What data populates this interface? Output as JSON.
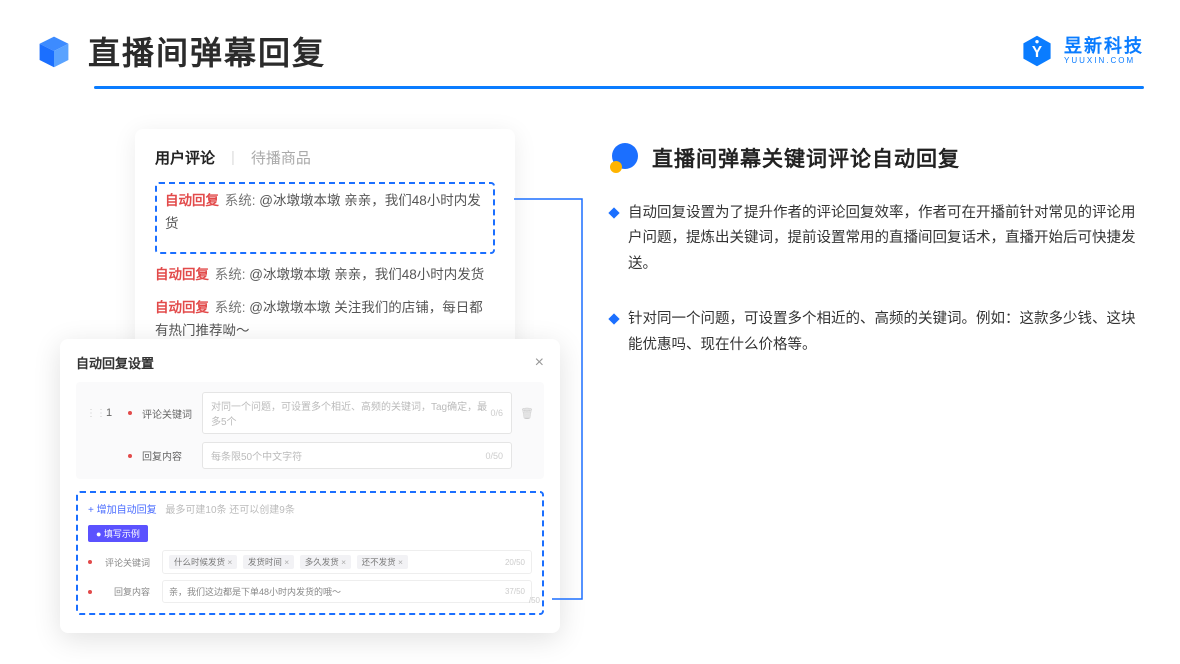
{
  "header": {
    "title": "直播间弹幕回复",
    "logo_cn": "昱新科技",
    "logo_en": "YUUXIN.COM"
  },
  "comments_panel": {
    "tab_active": "用户评论",
    "tab_inactive": "待播商品",
    "items": [
      {
        "badge": "自动回复",
        "sys": "系统:",
        "text": " @冰墩墩本墩 亲亲，我们48小时内发货"
      },
      {
        "badge": "自动回复",
        "sys": "系统:",
        "text": " @冰墩墩本墩 亲亲，我们48小时内发货"
      },
      {
        "badge": "自动回复",
        "sys": "系统:",
        "text": " @冰墩墩本墩 关注我们的店铺，每日都有热门推荐呦～"
      }
    ]
  },
  "settings_panel": {
    "title": "自动回复设置",
    "row_num": "1",
    "keyword_label": "评论关键词",
    "keyword_placeholder": "对同一个问题，可设置多个相近、高频的关键词，Tag确定，最多5个",
    "keyword_counter": "0/6",
    "content_label": "回复内容",
    "content_placeholder": "每条限50个中文字符",
    "content_counter": "0/50",
    "add_text": "+ 增加自动回复",
    "add_hint": "最多可建10条 还可以创建9条",
    "example_pill": "● 填写示例",
    "ex_kw_label": "评论关键词",
    "ex_tags": [
      "什么时候发货",
      "发货时间",
      "多久发货",
      "还不发货"
    ],
    "ex_kw_counter": "20/50",
    "ex_ct_label": "回复内容",
    "ex_ct_value": "亲，我们这边都是下单48小时内发货的哦～",
    "ex_ct_counter": "37/50",
    "stray_counter": "/50"
  },
  "right": {
    "section_title": "直播间弹幕关键词评论自动回复",
    "bullets": [
      "自动回复设置为了提升作者的评论回复效率，作者可在开播前针对常见的评论用户问题，提炼出关键词，提前设置常用的直播间回复话术，直播开始后可快捷发送。",
      "针对同一个问题，可设置多个相近的、高频的关键词。例如：这款多少钱、这块能优惠吗、现在什么价格等。"
    ]
  }
}
